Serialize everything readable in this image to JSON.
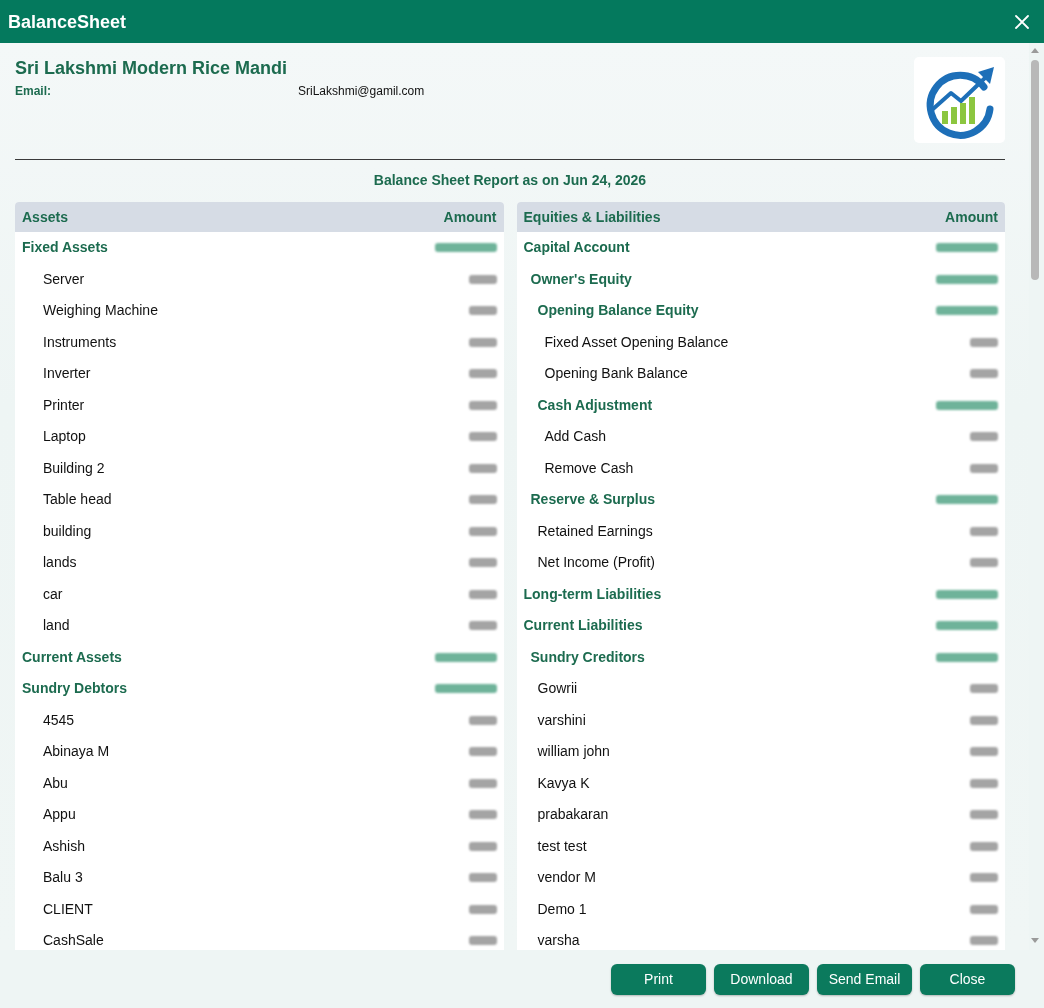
{
  "window": {
    "title": "BalanceSheet"
  },
  "company": {
    "name": "Sri Lakshmi Modern Rice Mandi",
    "email_label": "Email:",
    "email": "SriLakshmi@gamil.com"
  },
  "report_title": "Balance Sheet Report as on Jun 24, 2026",
  "tables": [
    {
      "columns": [
        "Assets",
        "Amount"
      ],
      "rows": [
        {
          "label": "Fixed Assets",
          "kind": "group",
          "children": [
            {
              "label": "Server",
              "kind": "item"
            },
            {
              "label": "Weighing Machine",
              "kind": "item"
            },
            {
              "label": "Instruments",
              "kind": "item"
            },
            {
              "label": "Inverter",
              "kind": "item"
            },
            {
              "label": "Printer",
              "kind": "item"
            },
            {
              "label": "Laptop",
              "kind": "item"
            },
            {
              "label": "Building 2",
              "kind": "item"
            },
            {
              "label": "Table head",
              "kind": "item"
            },
            {
              "label": "building",
              "kind": "item"
            },
            {
              "label": "lands",
              "kind": "item"
            },
            {
              "label": "car",
              "kind": "item"
            },
            {
              "label": "land",
              "kind": "item"
            }
          ]
        },
        {
          "label": "Current Assets",
          "kind": "group"
        },
        {
          "label": "Sundry Debtors",
          "kind": "group",
          "children": [
            {
              "label": "4545",
              "kind": "item"
            },
            {
              "label": "Abinaya M",
              "kind": "item"
            },
            {
              "label": "Abu",
              "kind": "item"
            },
            {
              "label": "Appu",
              "kind": "item"
            },
            {
              "label": "Ashish",
              "kind": "item"
            },
            {
              "label": "Balu 3",
              "kind": "item"
            },
            {
              "label": "CLIENT",
              "kind": "item"
            },
            {
              "label": "CashSale",
              "kind": "item"
            }
          ]
        }
      ]
    },
    {
      "columns": [
        "Equities & Liabilities",
        "Amount"
      ],
      "rows": [
        {
          "label": "Capital Account",
          "kind": "group",
          "children": [
            {
              "label": "Owner's Equity",
              "kind": "group",
              "children": [
                {
                  "label": "Opening Balance Equity",
                  "kind": "group",
                  "children": [
                    {
                      "label": "Fixed Asset Opening Balance",
                      "kind": "item"
                    },
                    {
                      "label": "Opening Bank Balance",
                      "kind": "item"
                    }
                  ]
                },
                {
                  "label": "Cash Adjustment",
                  "kind": "group",
                  "children": [
                    {
                      "label": "Add Cash",
                      "kind": "item"
                    },
                    {
                      "label": "Remove Cash",
                      "kind": "item"
                    }
                  ]
                }
              ]
            },
            {
              "label": "Reserve & Surplus",
              "kind": "group",
              "children": [
                {
                  "label": "Retained Earnings",
                  "kind": "item"
                },
                {
                  "label": "Net Income (Profit)",
                  "kind": "item"
                }
              ]
            }
          ]
        },
        {
          "label": "Long-term Liabilities",
          "kind": "group"
        },
        {
          "label": "Current Liabilities",
          "kind": "group",
          "children": [
            {
              "label": "Sundry Creditors",
              "kind": "group",
              "children": [
                {
                  "label": "Gowrii",
                  "kind": "item"
                },
                {
                  "label": "varshini",
                  "kind": "item"
                },
                {
                  "label": "william john",
                  "kind": "item"
                },
                {
                  "label": "Kavya K",
                  "kind": "item"
                },
                {
                  "label": "prabakaran",
                  "kind": "item"
                },
                {
                  "label": "test test",
                  "kind": "item"
                },
                {
                  "label": "vendor M",
                  "kind": "item"
                },
                {
                  "label": "Demo 1",
                  "kind": "item"
                },
                {
                  "label": "varsha",
                  "kind": "item"
                }
              ]
            }
          ]
        }
      ]
    }
  ],
  "buttons": [
    "Print",
    "Download",
    "Send Email",
    "Close"
  ]
}
